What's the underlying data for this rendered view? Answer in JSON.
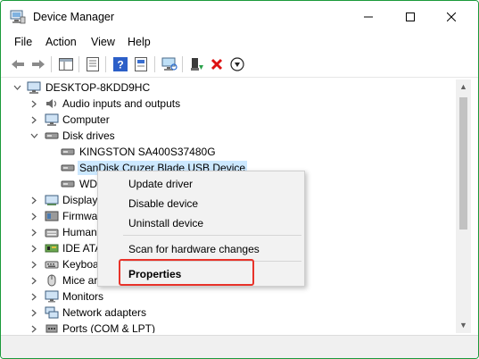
{
  "window": {
    "title": "Device Manager",
    "accent_color": "#1a9a3a"
  },
  "menu": {
    "items": [
      "File",
      "Action",
      "View",
      "Help"
    ]
  },
  "toolbar": {
    "icons": [
      "back-arrow-icon",
      "forward-arrow-icon",
      "show-hide-console-tree-icon",
      "properties-icon",
      "help-icon",
      "update-driver-icon",
      "scan-hardware-icon",
      "enable-device-icon",
      "uninstall-device-icon",
      "disable-device-icon"
    ]
  },
  "tree": {
    "root": "DESKTOP-8KDD9HC",
    "items": [
      {
        "label": "Audio inputs and outputs",
        "state": "collapsed"
      },
      {
        "label": "Computer",
        "state": "collapsed"
      },
      {
        "label": "Disk drives",
        "state": "expanded"
      },
      {
        "label": "KINGSTON SA400S37480G",
        "state": "leaf"
      },
      {
        "label": "SanDisk Cruzer Blade USB Device",
        "state": "leaf-selected"
      },
      {
        "label": "WD",
        "state": "leaf"
      },
      {
        "label": "Display",
        "state": "collapsed"
      },
      {
        "label": "Firmwa",
        "state": "collapsed"
      },
      {
        "label": "Human",
        "state": "collapsed"
      },
      {
        "label": "IDE ATA",
        "state": "collapsed"
      },
      {
        "label": "Keyboa",
        "state": "collapsed"
      },
      {
        "label": "Mice ar",
        "state": "collapsed"
      },
      {
        "label": "Monitors",
        "state": "collapsed"
      },
      {
        "label": "Network adapters",
        "state": "collapsed"
      },
      {
        "label": "Ports (COM & LPT)",
        "state": "collapsed"
      }
    ]
  },
  "context_menu": {
    "items": [
      "Update driver",
      "Disable device",
      "Uninstall device",
      "Scan for hardware changes",
      "Properties"
    ],
    "highlight_color": "#e8332a"
  }
}
